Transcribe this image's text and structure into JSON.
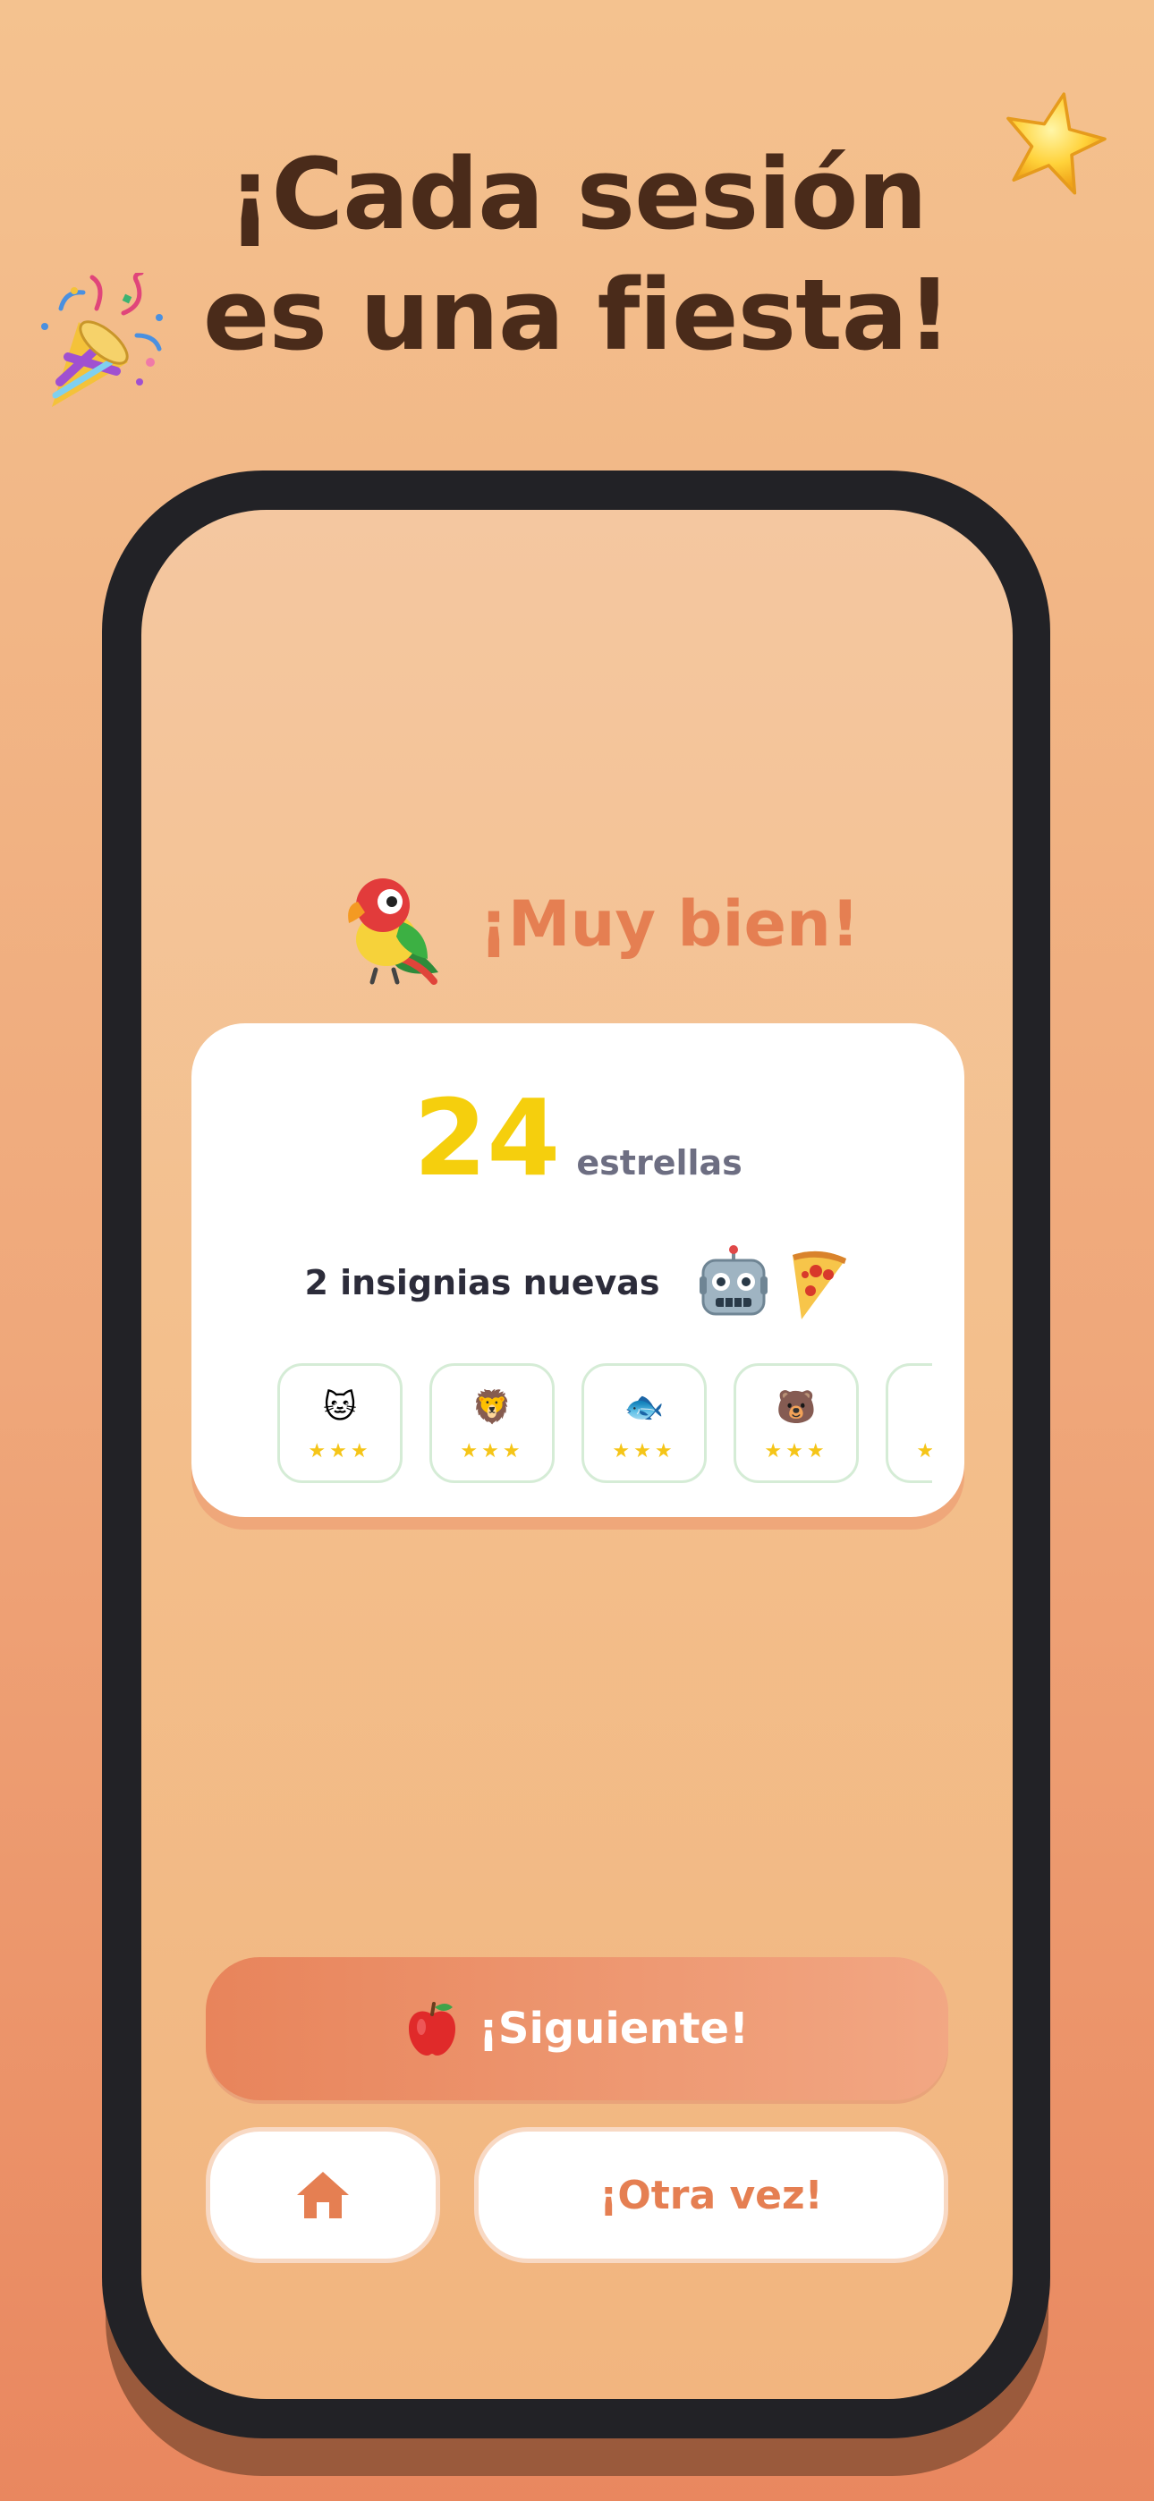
{
  "headline": {
    "line1": "¡Cada sesión",
    "line2": "es una fiesta!"
  },
  "decorations": {
    "top_right": "star-icon",
    "top_left": "party-popper-icon"
  },
  "result": {
    "mascot": "parrot-icon",
    "cheer": "¡Muy bien!"
  },
  "summary": {
    "stars_count": "24",
    "stars_label": "estrellas",
    "badges_label": "2 insignias nuevas",
    "badge_icons": [
      "robot-icon",
      "pizza-icon"
    ]
  },
  "tiles": [
    {
      "emoji": "🐱",
      "stars": "★★★",
      "name": "cat"
    },
    {
      "emoji": "🦁",
      "stars": "★★★",
      "name": "lion"
    },
    {
      "emoji": "🐟",
      "stars": "★★★",
      "name": "fish"
    },
    {
      "emoji": "🐻",
      "stars": "★★★",
      "name": "bear"
    },
    {
      "emoji": "",
      "stars": "★★★",
      "name": "partial"
    }
  ],
  "actions": {
    "next_label": "¡Siguiente!",
    "next_icon": "apple-icon",
    "home_icon": "home-icon",
    "again_label": "¡Otra vez!"
  },
  "colors": {
    "headline": "#4a2b1a",
    "accent": "#e57f52",
    "stars": "#f5cf0d",
    "phone_frame": "#222226"
  }
}
